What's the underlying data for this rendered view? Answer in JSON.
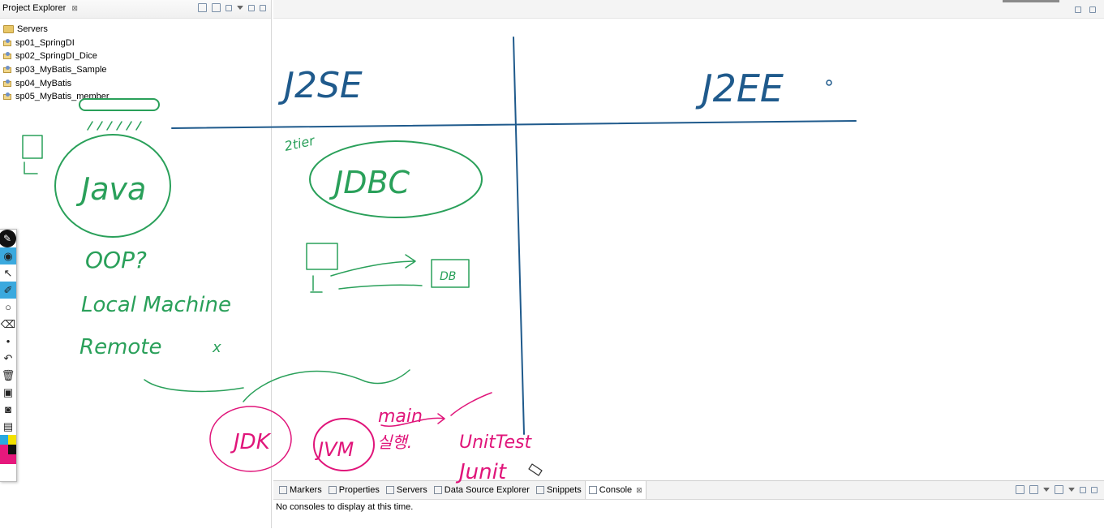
{
  "project_explorer": {
    "title": "Project Explorer",
    "close": "⊠",
    "items": [
      {
        "label": "Servers",
        "type": "folder"
      },
      {
        "label": "sp01_SpringDI",
        "type": "project"
      },
      {
        "label": "sp02_SpringDI_Dice",
        "type": "project"
      },
      {
        "label": "sp03_MyBatis_Sample",
        "type": "project"
      },
      {
        "label": "sp04_MyBatis",
        "type": "project"
      },
      {
        "label": "sp05_MyBatis_member",
        "type": "project"
      }
    ]
  },
  "bottom_panel": {
    "tabs": [
      {
        "label": "Markers",
        "icon": "markers-icon",
        "active": false
      },
      {
        "label": "Properties",
        "icon": "properties-icon",
        "active": false
      },
      {
        "label": "Servers",
        "icon": "servers-icon",
        "active": false
      },
      {
        "label": "Data Source Explorer",
        "icon": "datasource-icon",
        "active": false
      },
      {
        "label": "Snippets",
        "icon": "snippets-icon",
        "active": false
      },
      {
        "label": "Console",
        "icon": "console-icon",
        "active": true
      }
    ],
    "close": "⊠",
    "message": "No consoles to display at this time."
  },
  "handwriting": {
    "heading_left": "J2SE",
    "heading_right": "J2EE",
    "java": "Java",
    "jdbc": "JDBC",
    "two_tier": "2tier",
    "oop": "OOP?",
    "local_machine": "Local Machine",
    "remote": "Remote",
    "remote_mark": "x",
    "db": "DB",
    "jdk": "JDK",
    "jvm": "JVM",
    "main": "main",
    "run": "실행.",
    "unittest": "UnitTest",
    "junit": "Junit"
  },
  "colors": {
    "ink_blue": "#1f5a8c",
    "ink_green": "#2aa05a",
    "ink_pink": "#e0157a",
    "accent": "#3ba9de"
  },
  "palette": {
    "tools": [
      "pen-icon",
      "eye-icon",
      "pointer-icon",
      "highlighter-icon",
      "circle-icon",
      "eraser-icon",
      "dot-icon",
      "undo-icon",
      "trash-icon",
      "monitor-icon",
      "camera-icon",
      "clipboard-icon"
    ],
    "swatches": [
      "#29a9e0",
      "#f2e100",
      "#e6187c",
      "#111111",
      "#e6187c",
      "#e6187c"
    ]
  }
}
